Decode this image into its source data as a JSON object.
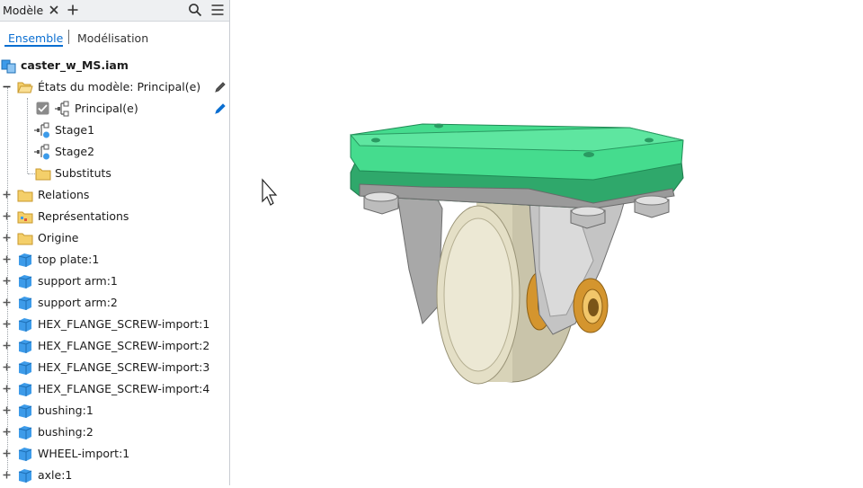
{
  "panel": {
    "title": "Modèle",
    "tabs": {
      "active": "Ensemble",
      "inactive": "Modélisation"
    }
  },
  "tree": {
    "root": "caster_w_MS.iam",
    "model_states": "États du modèle: Principal(e)",
    "states": [
      "Principal(e)",
      "Stage1",
      "Stage2"
    ],
    "substitutes": "Substituts",
    "folders": [
      "Relations",
      "Représentations",
      "Origine"
    ],
    "parts": [
      "top plate:1",
      "support arm:1",
      "support arm:2",
      "HEX_FLANGE_SCREW-import:1",
      "HEX_FLANGE_SCREW-import:2",
      "HEX_FLANGE_SCREW-import:3",
      "HEX_FLANGE_SCREW-import:4",
      "bushing:1",
      "bushing:2",
      "WHEEL-import:1",
      "axle:1"
    ]
  },
  "icons": {
    "close": "close-icon",
    "add": "plus-icon",
    "search": "search-icon",
    "menu": "hamburger-menu-icon",
    "assembly": "assembly-icon",
    "folder": "folder-icon",
    "part": "part-cube-icon",
    "edit": "pencil-icon",
    "cursor": "mouse-pointer-icon"
  },
  "colors": {
    "accent": "#0a6ed1",
    "folder": "#f4cf6a",
    "part": "#3d9be9",
    "top_plate": "#3fd98a",
    "wheel": "#dcd7bd",
    "bushing": "#d4952e",
    "metal": "#b9b9b9"
  }
}
